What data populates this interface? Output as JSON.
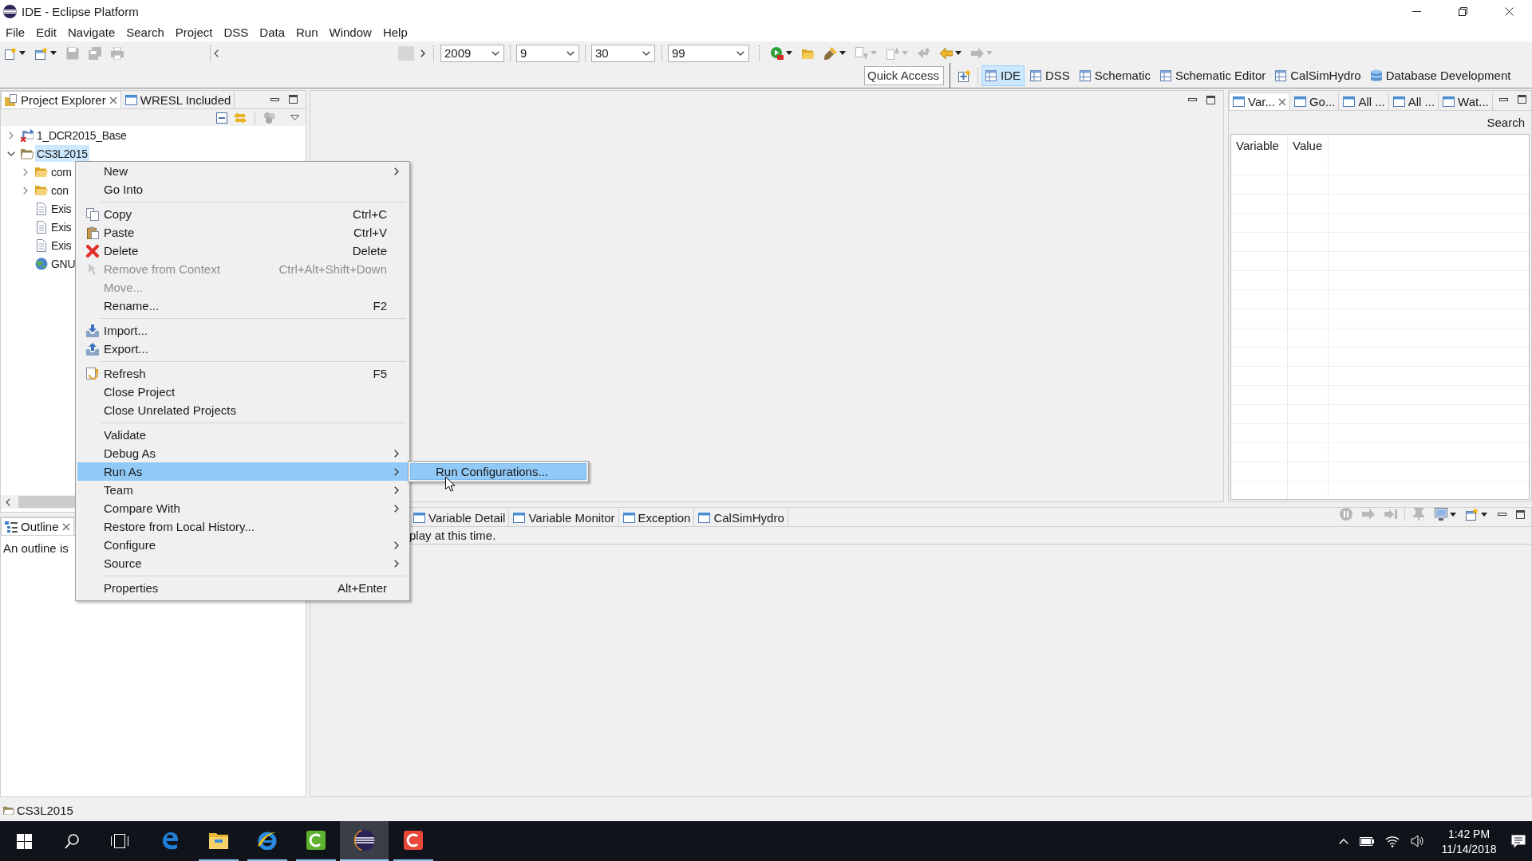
{
  "window": {
    "title": "IDE - Eclipse Platform"
  },
  "menu_bar": [
    "File",
    "Edit",
    "Navigate",
    "Search",
    "Project",
    "DSS",
    "Data",
    "Run",
    "Window",
    "Help"
  ],
  "main_toolbar": {
    "left_buttons": [
      {
        "kind": "new",
        "disabled": false,
        "dropdown": true
      },
      {
        "kind": "wizard",
        "disabled": false,
        "dropdown": true
      },
      {
        "kind": "save",
        "disabled": true,
        "dropdown": false
      },
      {
        "kind": "saveall",
        "disabled": true,
        "dropdown": false
      },
      {
        "kind": "print",
        "disabled": true,
        "dropdown": false
      }
    ],
    "combos": [
      {
        "value": "2009"
      },
      {
        "value": "9"
      },
      {
        "value": "30"
      },
      {
        "value": "99"
      }
    ],
    "right_buttons": [
      {
        "kind": "run",
        "disabled": false,
        "dropdown": true
      },
      {
        "kind": "open",
        "disabled": false,
        "dropdown": false
      },
      {
        "kind": "brush",
        "disabled": false,
        "dropdown": true
      },
      {
        "kind": "next",
        "disabled": true,
        "dropdown": true
      },
      {
        "kind": "previous",
        "disabled": true,
        "dropdown": true
      },
      {
        "kind": "lastedit",
        "disabled": true,
        "dropdown": false
      },
      {
        "kind": "back",
        "disabled": false,
        "dropdown": true
      },
      {
        "kind": "forward",
        "disabled": true,
        "dropdown": true
      }
    ],
    "quick_access": {
      "placeholder": "Quick Access"
    },
    "perspectives": [
      {
        "kind": "table",
        "label": "IDE",
        "selected": true
      },
      {
        "kind": "table",
        "label": "DSS",
        "selected": false
      },
      {
        "kind": "table",
        "label": "Schematic",
        "selected": false
      },
      {
        "kind": "table",
        "label": "Schematic Editor",
        "selected": false
      },
      {
        "kind": "table",
        "label": "CalSimHydro",
        "selected": false
      },
      {
        "kind": "database",
        "label": "Database Development",
        "selected": false
      }
    ]
  },
  "project_explorer": {
    "tabs": [
      {
        "kind": "explorer",
        "label": "Project Explorer",
        "selected": true
      },
      {
        "kind": "window",
        "label": "WRESL Included",
        "selected": false
      }
    ],
    "tree": [
      {
        "kind": "project",
        "label": "1_DCR2015_Base",
        "expanded": false,
        "selected": false,
        "error": true
      },
      {
        "kind": "project",
        "label": "CS3L2015",
        "expanded": true,
        "selected": true,
        "error": false,
        "children": [
          {
            "kind": "folder",
            "label": "com",
            "expanded": false,
            "selected": false
          },
          {
            "kind": "folder",
            "label": "con",
            "expanded": false,
            "selected": false
          },
          {
            "kind": "file",
            "label": "Exis",
            "selected": false
          },
          {
            "kind": "file",
            "label": "Exis",
            "selected": false
          },
          {
            "kind": "file",
            "label": "Exis",
            "selected": false
          },
          {
            "kind": "library",
            "label": "GNU",
            "selected": false
          }
        ]
      }
    ]
  },
  "outline": {
    "tabs": [
      {
        "kind": "outline",
        "label": "Outline",
        "selected": true
      }
    ],
    "message": "An outline is"
  },
  "variables_view": {
    "tabs": [
      {
        "kind": "window",
        "label": "Var...",
        "selected": true
      },
      {
        "kind": "window",
        "label": "Go...",
        "selected": false
      },
      {
        "kind": "window",
        "label": "All ...",
        "selected": false
      },
      {
        "kind": "window",
        "label": "All ...",
        "selected": false
      },
      {
        "kind": "window",
        "label": "Wat...",
        "selected": false
      }
    ],
    "search_button": "Search",
    "table": {
      "columns": [
        "Variable",
        "Value"
      ]
    }
  },
  "bottom_panel": {
    "tabs": [
      {
        "kind": "window",
        "label": "Variable Detail",
        "selected": false
      },
      {
        "kind": "window",
        "label": "Variable Monitor",
        "selected": false
      },
      {
        "kind": "window",
        "label": "Exception",
        "selected": false
      },
      {
        "kind": "window",
        "label": "CalSimHydro",
        "selected": false
      }
    ],
    "actions": [
      {
        "kind": "terminate",
        "disabled": true,
        "dropdown": false
      },
      {
        "kind": "step",
        "disabled": true,
        "dropdown": false
      },
      {
        "kind": "skip",
        "disabled": true,
        "dropdown": false
      },
      {
        "kind": "pin",
        "disabled": true,
        "dropdown": false
      },
      {
        "kind": "display",
        "disabled": false,
        "dropdown": true
      },
      {
        "kind": "newview",
        "disabled": false,
        "dropdown": true
      }
    ],
    "message": "play at this time."
  },
  "context_menu": {
    "groups": [
      {
        "items": [
          {
            "label": "New",
            "submenu": true,
            "disabled": false,
            "selected": false
          },
          {
            "label": "Go Into",
            "submenu": false,
            "disabled": false,
            "selected": false
          }
        ]
      },
      {
        "items": [
          {
            "label": "Copy",
            "shortcut": "Ctrl+C",
            "submenu": false,
            "disabled": false,
            "selected": false
          },
          {
            "label": "Paste",
            "shortcut": "Ctrl+V",
            "submenu": false,
            "disabled": false,
            "selected": false
          },
          {
            "label": "Delete",
            "shortcut": "Delete",
            "submenu": false,
            "disabled": false,
            "selected": false
          },
          {
            "label": "Remove from Context",
            "shortcut": "Ctrl+Alt+Shift+Down",
            "submenu": false,
            "disabled": true,
            "selected": false
          },
          {
            "label": "Move...",
            "submenu": false,
            "disabled": true,
            "selected": false
          },
          {
            "label": "Rename...",
            "shortcut": "F2",
            "submenu": false,
            "disabled": false,
            "selected": false
          }
        ]
      },
      {
        "items": [
          {
            "label": "Import...",
            "submenu": false,
            "disabled": false,
            "selected": false
          },
          {
            "label": "Export...",
            "submenu": false,
            "disabled": false,
            "selected": false
          }
        ]
      },
      {
        "items": [
          {
            "label": "Refresh",
            "shortcut": "F5",
            "submenu": false,
            "disabled": false,
            "selected": false
          },
          {
            "label": "Close Project",
            "submenu": false,
            "disabled": false,
            "selected": false
          },
          {
            "label": "Close Unrelated Projects",
            "submenu": false,
            "disabled": false,
            "selected": false
          }
        ]
      },
      {
        "items": [
          {
            "label": "Validate",
            "submenu": false,
            "disabled": false,
            "selected": false
          },
          {
            "label": "Debug As",
            "submenu": true,
            "disabled": false,
            "selected": false
          },
          {
            "label": "Run As",
            "submenu": true,
            "disabled": false,
            "selected": true
          },
          {
            "label": "Team",
            "submenu": true,
            "disabled": false,
            "selected": false
          },
          {
            "label": "Compare With",
            "submenu": true,
            "disabled": false,
            "selected": false
          },
          {
            "label": "Restore from Local History...",
            "submenu": false,
            "disabled": false,
            "selected": false
          },
          {
            "label": "Configure",
            "submenu": true,
            "disabled": false,
            "selected": false
          },
          {
            "label": "Source",
            "submenu": true,
            "disabled": false,
            "selected": false
          }
        ]
      },
      {
        "items": [
          {
            "label": "Properties",
            "shortcut": "Alt+Enter",
            "submenu": false,
            "disabled": false,
            "selected": false
          }
        ]
      }
    ]
  },
  "submenu": {
    "items": [
      {
        "label": "Run Configurations...",
        "selected": true
      }
    ]
  },
  "status_bar": {
    "label": "CS3L2015"
  },
  "taskbar": {
    "apps": [
      {
        "kind": "swirl",
        "running": false,
        "active": false
      },
      {
        "kind": "folder",
        "running": true,
        "active": false
      },
      {
        "kind": "ring",
        "running": true,
        "active": false
      },
      {
        "kind": "tile",
        "color": "#5fb130",
        "running": true,
        "active": false
      },
      {
        "kind": "sphere",
        "running": true,
        "active": true
      },
      {
        "kind": "tile",
        "color": "#e9473a",
        "running": true,
        "active": false
      }
    ],
    "clock": {
      "time": "1:42 PM",
      "date": "11/14/2018"
    }
  }
}
